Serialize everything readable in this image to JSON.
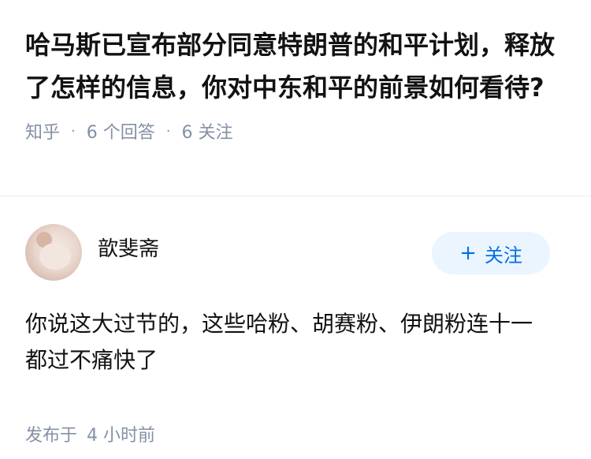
{
  "question": {
    "title": "哈马斯已宣布部分同意特朗普的和平计划，释放了怎样的信息，你对中东和平的前景如何看待?",
    "source": "知乎",
    "separator": "·",
    "answers_count": "6 个回答",
    "followers_count": "6 关注"
  },
  "answer": {
    "author_name": "歆斐斋",
    "follow_button": {
      "icon": "+",
      "label": "关注"
    },
    "content": "你说这大过节的，这些哈粉、胡赛粉、伊朗粉连十一都过不痛快了",
    "published_label": "发布于",
    "published_time": "4 小时前"
  },
  "colors": {
    "meta_gray": "#8590a6",
    "follow_bg": "#ebf5ff",
    "follow_text": "#056de8",
    "divider": "#ebebeb"
  },
  "icons": {
    "avatar": "avatar-image",
    "follow": "plus-icon"
  }
}
